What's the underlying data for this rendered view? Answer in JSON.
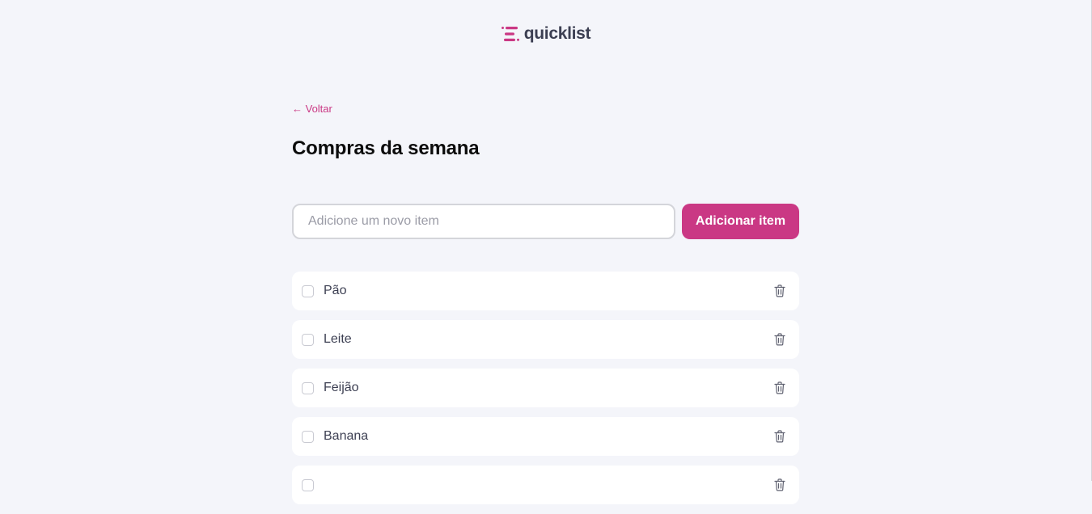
{
  "brand": {
    "name": "quicklist",
    "logo_icon": "list-lines-icon"
  },
  "nav": {
    "back_label": "← Voltar"
  },
  "page": {
    "title": "Compras da semana"
  },
  "form": {
    "input_value": "",
    "input_placeholder": "Adicione um novo item",
    "add_button_label": "Adicionar item"
  },
  "items": [
    {
      "label": "Pão",
      "checked": false,
      "delete_icon": "trash-icon"
    },
    {
      "label": "Leite",
      "checked": false,
      "delete_icon": "trash-icon"
    },
    {
      "label": "Feijão",
      "checked": false,
      "delete_icon": "trash-icon"
    },
    {
      "label": "Banana",
      "checked": false,
      "delete_icon": "trash-icon"
    },
    {
      "label": "",
      "checked": false,
      "delete_icon": "trash-icon"
    }
  ],
  "colors": {
    "accent": "#CA3884",
    "background": "#F4F5FA",
    "card": "#FFFFFF",
    "text_primary": "#0C0C0C",
    "text_secondary": "#3C3F52",
    "border": "#D4D5DA",
    "placeholder": "#9A9BA6"
  }
}
